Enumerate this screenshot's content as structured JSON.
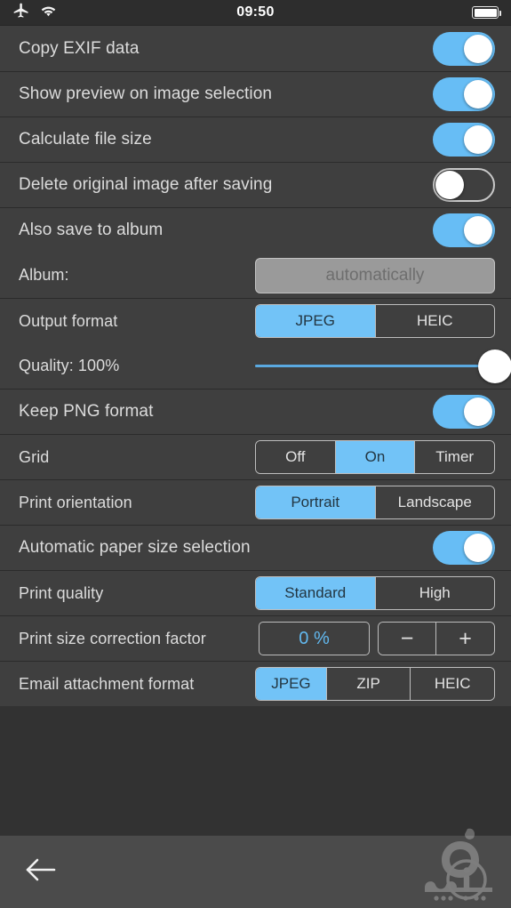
{
  "statusbar": {
    "time": "09:50",
    "icons": [
      "airplane-mode-icon",
      "wifi-icon",
      "battery-icon"
    ],
    "battery_level": 100
  },
  "colors": {
    "accent": "#72c3f7",
    "row_bg": "#3f3f3f",
    "page_bg": "#323232",
    "bottom_bar": "#4b4b4b",
    "label_text": "#dcdcdc",
    "separator": "#2b2b2b",
    "stepper_value_text": "#62b9f0"
  },
  "settings": {
    "rows": [
      {
        "label": "Copy EXIF data",
        "type": "switch",
        "value": true
      },
      {
        "label": "Show preview on image selection",
        "type": "switch",
        "value": true
      },
      {
        "label": "Calculate file size",
        "type": "switch",
        "value": true
      },
      {
        "label": "Delete original image after saving",
        "type": "switch",
        "value": false
      },
      {
        "label": "Also save to album",
        "type": "switch",
        "value": true
      },
      {
        "label": "Album:",
        "type": "textfield",
        "value": "",
        "placeholder": "automatically"
      },
      {
        "label": "Output format",
        "type": "segmented",
        "options": [
          "JPEG",
          "HEIC"
        ],
        "selected": "JPEG"
      },
      {
        "label": "Quality: 100%",
        "type": "slider",
        "value": 100,
        "min": 0,
        "max": 100
      },
      {
        "label": "Keep PNG format",
        "type": "switch",
        "value": true
      },
      {
        "label": "Grid",
        "type": "segmented",
        "options": [
          "Off",
          "On",
          "Timer"
        ],
        "selected": "On"
      },
      {
        "label": "Print orientation",
        "type": "segmented",
        "options": [
          "Portrait",
          "Landscape"
        ],
        "selected": "Portrait"
      },
      {
        "label": "Automatic paper size selection",
        "type": "switch",
        "value": true
      },
      {
        "label": "Print quality",
        "type": "segmented",
        "options": [
          "Standard",
          "High"
        ],
        "selected": "Standard"
      },
      {
        "label": "Print size correction factor",
        "type": "stepper",
        "value": "0 %",
        "decrement": "−",
        "increment": "+"
      },
      {
        "label": "Email attachment format",
        "type": "segmented",
        "options": [
          "JPEG",
          "ZIP",
          "HEIC"
        ],
        "selected": "JPEG"
      }
    ]
  },
  "bottombar": {
    "back_label": "back-arrow",
    "watermark": "sibapp-logo-watermark"
  }
}
